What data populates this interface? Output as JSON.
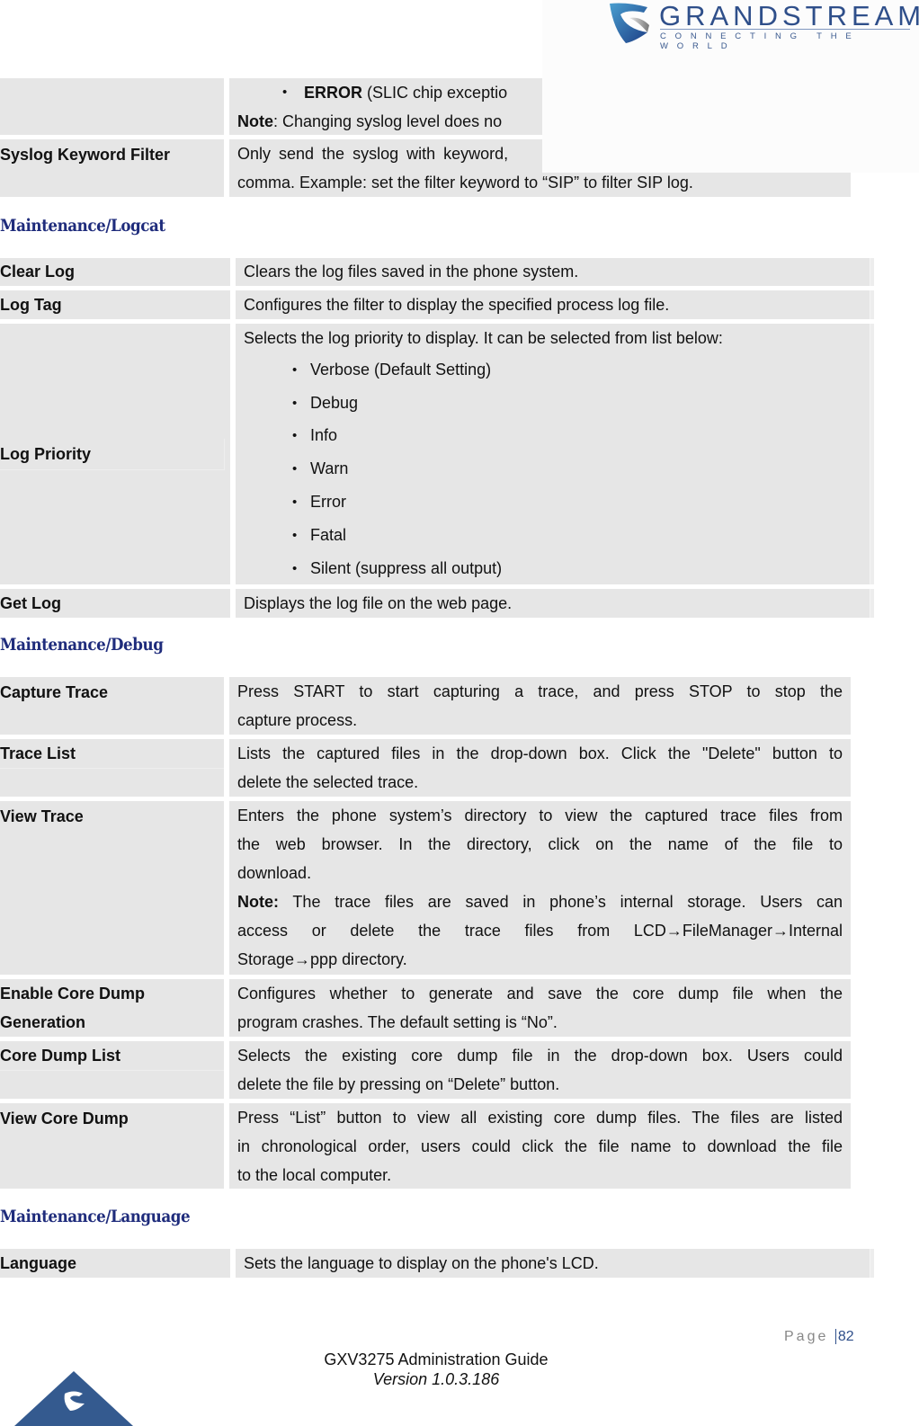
{
  "header": {
    "brand": "GRANDSTREAM",
    "tagline": "CONNECTING THE WORLD",
    "brand_color": "#2f4f8a"
  },
  "syslog_rows": [
    {
      "label": "",
      "bullet_bold": "ERROR",
      "bullet_rest": " (SLIC chip exceptio",
      "note_label": "Note",
      "note_text": ": Changing syslog level does no"
    },
    {
      "label": "Syslog Keyword Filter",
      "line1": "Only send the syslog with keyword,",
      "line2": "comma. Example: set the filter keyword to “SIP” to filter SIP log."
    }
  ],
  "sections": {
    "logcat": {
      "title": "Maintenance/Logcat",
      "rows": [
        {
          "label": "Clear Log",
          "text": "Clears the log files saved in the phone system."
        },
        {
          "label": "Log Tag",
          "text": "Configures the filter to display the specified process log file."
        },
        {
          "label": "Log Priority",
          "text": "Selects the log priority to display. It can be selected from list below:",
          "options": [
            "Verbose (Default Setting)",
            "Debug",
            "Info",
            "Warn",
            "Error",
            "Fatal",
            "Silent (suppress all output)"
          ]
        },
        {
          "label": "Get Log",
          "text": "Displays the log file on the web page."
        }
      ]
    },
    "debug": {
      "title": "Maintenance/Debug",
      "rows": [
        {
          "label": "Capture Trace",
          "lines": [
            "Press START to start capturing a trace, and press STOP to stop the",
            "capture process."
          ]
        },
        {
          "label": "Trace List",
          "lines": [
            "Lists the captured files in the drop-down box. Click the \"Delete\" button to",
            "delete the selected trace."
          ]
        },
        {
          "label": "View Trace",
          "lines": [
            "Enters the phone system’s directory to view the captured trace files from",
            "the web browser. In the directory, click on the name of the file to",
            "download."
          ],
          "note_label": "Note:",
          "note_lines": [
            " The trace files are saved in phone’s internal storage. Users can",
            "access or delete the trace files from LCD→FileManager→Internal",
            "Storage→ppp directory."
          ]
        },
        {
          "label_lines": [
            "Enable Core Dump",
            "Generation"
          ],
          "lines": [
            "Configures whether to generate and save the core dump file when the",
            "program crashes. The default setting is “No”."
          ]
        },
        {
          "label": "Core Dump List",
          "lines": [
            "Selects the existing core dump file in the drop-down box. Users could",
            "delete the file by pressing on “Delete” button."
          ]
        },
        {
          "label": "View Core Dump",
          "lines": [
            "Press “List” button to view all existing core dump files. The files are listed",
            "in chronological order, users could click the file name to download the file",
            "to the local computer."
          ]
        }
      ]
    },
    "language": {
      "title": "Maintenance/Language",
      "rows": [
        {
          "label": "Language",
          "text": "Sets the language to display on the phone's LCD."
        }
      ]
    }
  },
  "footer": {
    "page_label": "Page",
    "page_number": "82",
    "guide_title": "GXV3275 Administration Guide",
    "version": "Version 1.0.3.186"
  }
}
